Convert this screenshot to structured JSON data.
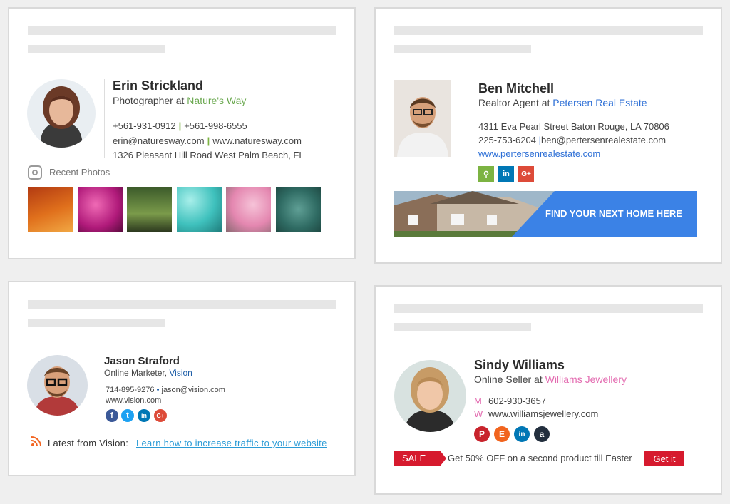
{
  "card1": {
    "name": "Erin Strickland",
    "title_prefix": "Photographer at ",
    "company": "Nature's Way",
    "phone1": "+561-931-0912",
    "sep": "|",
    "phone2": "+561-998-6555",
    "email": "erin@naturesway.com",
    "website": "www.naturesway.com",
    "address": "1326 Pleasant Hill Road West Palm Beach, FL",
    "recent_photos_label": "Recent Photos",
    "accent": "#6aa84f"
  },
  "card2": {
    "name": "Ben Mitchell",
    "title_prefix": "Realtor Agent at ",
    "company": "Petersen Real Estate",
    "address": "4311 Eva Pearl Street Baton Rouge, LA 70806",
    "phone": "225-753-6204",
    "sep": "|",
    "email": "ben@pertersenrealestate.com",
    "website": "www.pertersenrealestate.com",
    "banner_text": "FIND YOUR NEXT HOME HERE",
    "social": [
      {
        "icon": "map-pin-icon",
        "glyph": "⚲",
        "color": "#7cb342"
      },
      {
        "icon": "linkedin-icon",
        "glyph": "in",
        "color": "#0077b5"
      },
      {
        "icon": "google-plus-icon",
        "glyph": "G+",
        "color": "#dd4b39"
      }
    ],
    "accent": "#2d6fd6"
  },
  "card3": {
    "name": "Jason Straford",
    "title_prefix": "Online Marketer, ",
    "company": "Vision",
    "phone": "714-895-9276",
    "bullet": "•",
    "email": "jason@vision.com",
    "website": "www.vision.com",
    "latest_label": "Latest from Vision:",
    "latest_link": "Learn how to increase traffic to your website",
    "social": [
      {
        "icon": "facebook-icon",
        "glyph": "f",
        "color": "#3b5998"
      },
      {
        "icon": "twitter-icon",
        "glyph": "t",
        "color": "#1da1f2"
      },
      {
        "icon": "linkedin-icon",
        "glyph": "in",
        "color": "#0077b5"
      },
      {
        "icon": "google-plus-icon",
        "glyph": "G+",
        "color": "#dd4b39"
      }
    ]
  },
  "card4": {
    "name": "Sindy Williams",
    "title_prefix": "Online Seller at ",
    "company": "Williams Jewellery",
    "m_label": "M",
    "phone": "602-930-3657",
    "w_label": "W",
    "website": "www.williamsjewellery.com",
    "sale_label": "SALE",
    "promo_text": "Get 50% OFF on a second product till Easter",
    "cta_label": "Get it",
    "social": [
      {
        "icon": "pinterest-icon",
        "glyph": "P",
        "color": "#c8232c"
      },
      {
        "icon": "etsy-icon",
        "glyph": "E",
        "color": "#f1641e"
      },
      {
        "icon": "linkedin-icon",
        "glyph": "in",
        "color": "#0077b5"
      },
      {
        "icon": "amazon-icon",
        "glyph": "a",
        "color": "#232f3e"
      }
    ],
    "accent": "#e36bb0",
    "sale_color": "#d61a2e"
  }
}
